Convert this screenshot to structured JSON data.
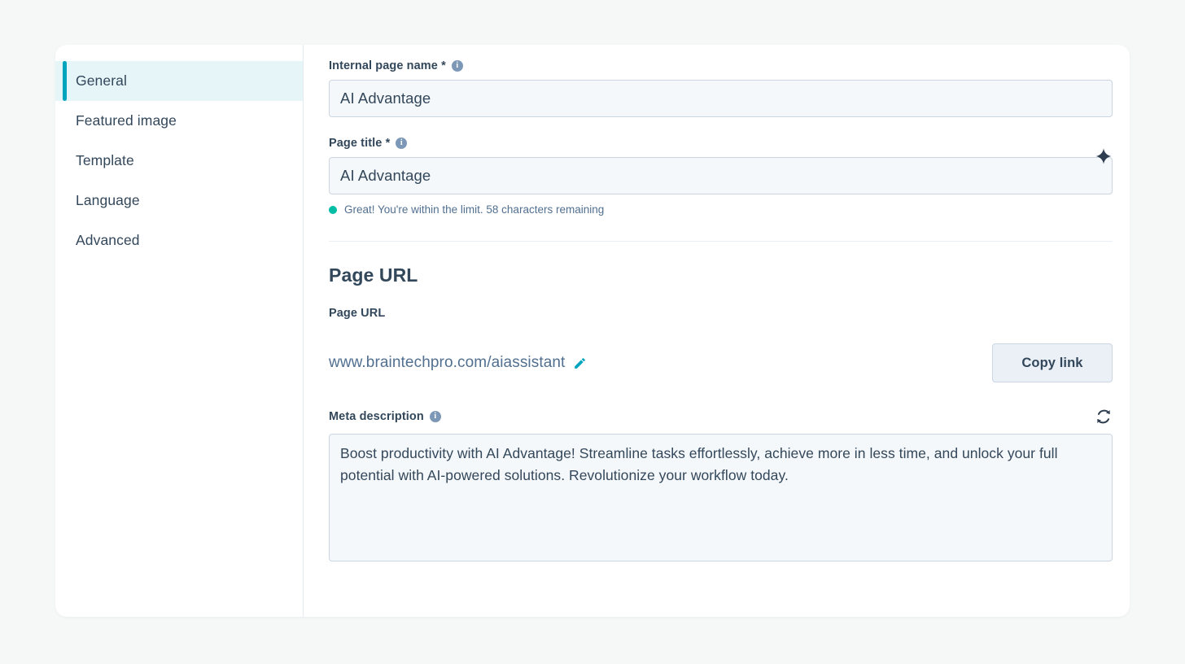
{
  "sidebar": {
    "items": [
      {
        "label": "General",
        "name": "general",
        "active": true
      },
      {
        "label": "Featured image",
        "name": "featured-image",
        "active": false
      },
      {
        "label": "Template",
        "name": "template",
        "active": false
      },
      {
        "label": "Language",
        "name": "language",
        "active": false
      },
      {
        "label": "Advanced",
        "name": "advanced",
        "active": false
      }
    ]
  },
  "form": {
    "internal_page_name": {
      "label": "Internal page name *",
      "value": "AI Advantage",
      "placeholder": "Internal page name",
      "info_glyph": "i"
    },
    "page_title": {
      "label": "Page title *",
      "value": "AI Advantage",
      "placeholder": "Page title",
      "info_glyph": "i",
      "helper_text": "Great! You're within the limit. 58 characters remaining",
      "helper_status_color": "#00bda5",
      "ai_icon": "sparkle-icon"
    },
    "page_url_section": {
      "heading": "Page URL",
      "label": "Page URL",
      "url": "www.braintechpro.com/aiassistant",
      "edit_icon": "pencil-icon",
      "copy_button_label": "Copy link"
    },
    "meta_description": {
      "label": "Meta description",
      "info_glyph": "i",
      "regenerate_icon": "refresh-icon",
      "value": "Boost productivity with AI Advantage! Streamline tasks effortlessly, achieve more in less time, and unlock your full potential with AI-powered solutions. Revolutionize your workflow today.",
      "placeholder": "Meta description"
    }
  },
  "theme": {
    "accent": "#00a4bd",
    "text": "#33475b",
    "muted": "#516f90",
    "border": "#cbd6e2",
    "field_bg": "#f5f8fa",
    "active_bg": "#e5f5f8",
    "page_bg": "#f5f8f7"
  }
}
